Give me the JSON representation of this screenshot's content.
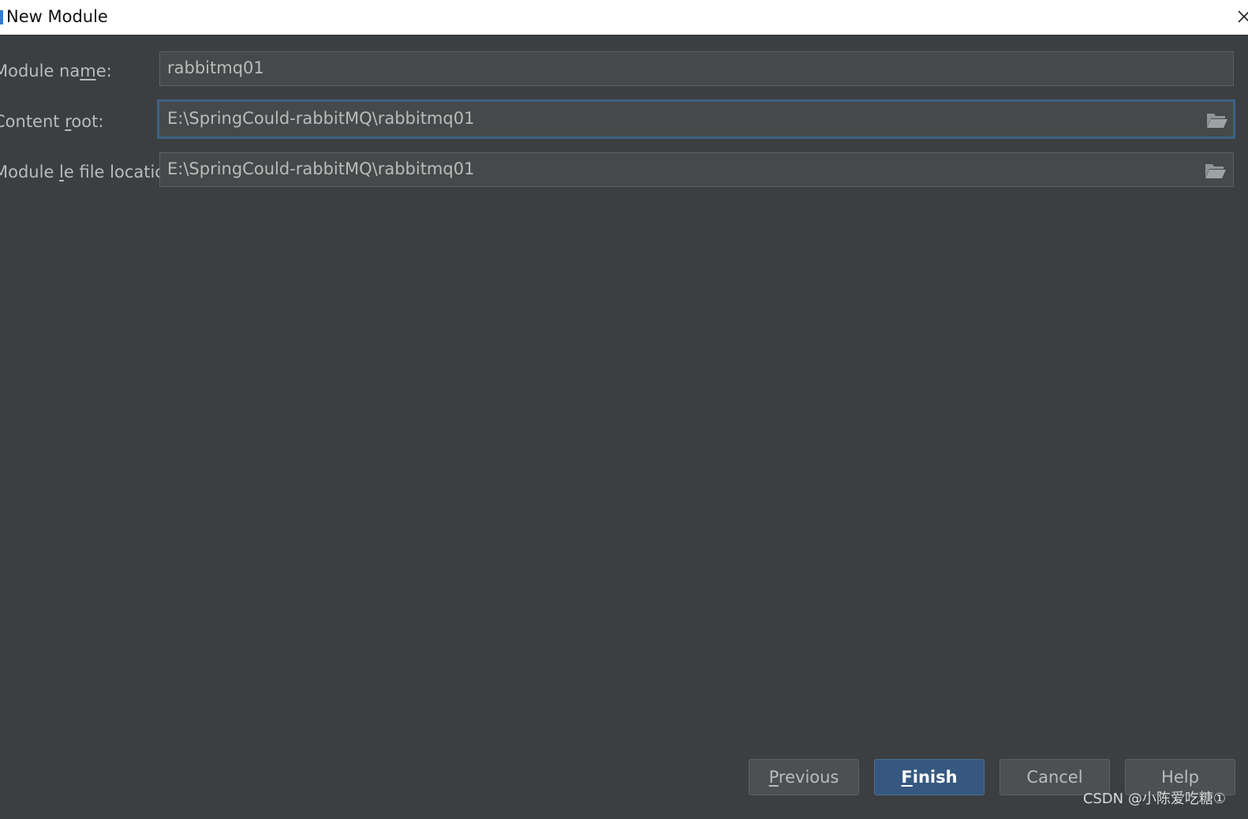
{
  "window": {
    "title": "New Module",
    "accent": "#2f7bd9"
  },
  "form": {
    "module_name": {
      "label_pre": "Module na",
      "label_mn": "m",
      "label_post": "e:",
      "value": "rabbitmq01"
    },
    "content_root": {
      "label_pre": "Content ",
      "label_mn": "r",
      "label_post": "oot:",
      "value": "E:\\SpringCould-rabbitMQ\\rabbitmq01"
    },
    "module_file_location": {
      "label_pre": "Module ",
      "label_mn": "l",
      "label_post": "e file location:",
      "value": "E:\\SpringCould-rabbitMQ\\rabbitmq01"
    }
  },
  "buttons": {
    "previous": {
      "mn": "P",
      "rest": "revious"
    },
    "finish": {
      "mn": "F",
      "rest": "inish"
    },
    "cancel": "Cancel",
    "help": "Help"
  },
  "watermark": "CSDN @小陈爱吃糖①"
}
